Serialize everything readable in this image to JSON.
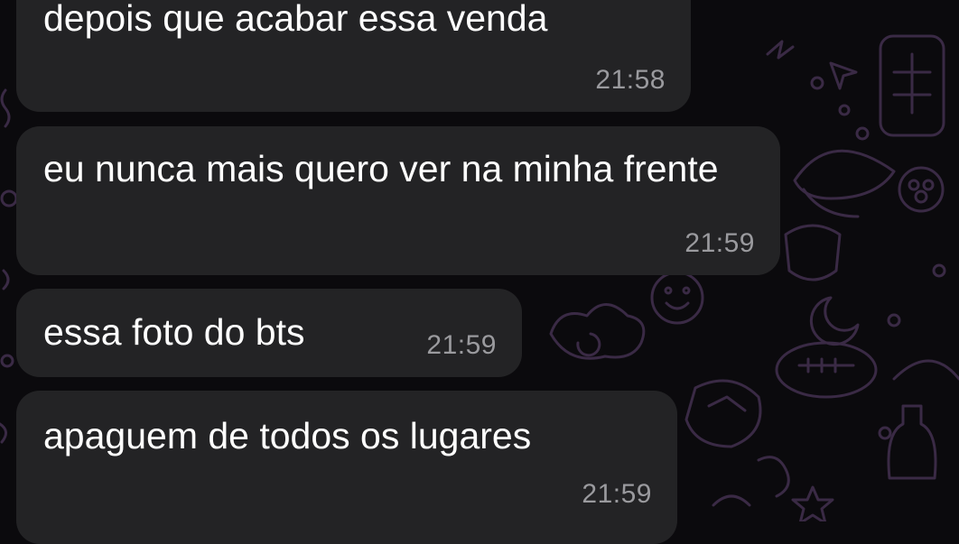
{
  "messages": [
    {
      "text": "depois que acabar essa venda",
      "time": "21:58"
    },
    {
      "text": "eu nunca mais quero ver na minha frente",
      "time": "21:59"
    },
    {
      "text": "essa foto do bts",
      "time": "21:59"
    },
    {
      "text": "apaguem de todos os lugares",
      "time": "21:59"
    }
  ],
  "theme": {
    "background": "#0b0a0d",
    "bubble": "#232325",
    "doodle": "#3a2a45",
    "time_color": "#9a9a9e"
  }
}
